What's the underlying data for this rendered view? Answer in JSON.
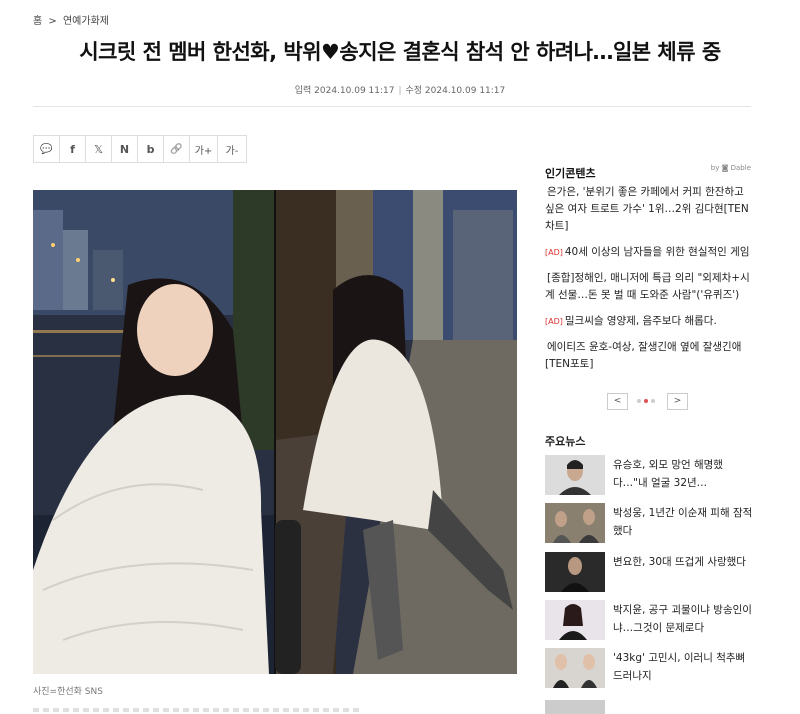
{
  "breadcrumb": {
    "home": "홈",
    "sep": ">",
    "section": "연예가화제"
  },
  "article": {
    "headline": "시크릿 전 멤버 한선화, 박위♥송지은 결혼식 참석 안 하려나…일본 체류 중",
    "input_label": "입력 2024.10.09 11:17",
    "date_sep": "|",
    "edit_label": "수정 2024.10.09 11:17",
    "caption": "사진=한선화 SNS"
  },
  "toolbar": {
    "comment_icon": "💬",
    "facebook_icon": "f",
    "x_icon": "𝕏",
    "naver_icon": "N",
    "band_icon": "b",
    "link_icon": "🔗",
    "font_up_label": "가+",
    "font_down_label": "가-"
  },
  "sidebar": {
    "popular_title": "인기콘텐츠",
    "dable_label": "by ◙ Dable",
    "popular": [
      {
        "ad": "",
        "text": "은가은, '분위기 좋은 카페에서 커피 한잔하고 싶은 여자 트로트 가수' 1위…2위 김다현[TEN차트]"
      },
      {
        "ad": "[AD]",
        "text": "40세 이상의 남자들을 위한 현실적인 게임"
      },
      {
        "ad": "",
        "text": "[종합]정해인, 매니저에 특급 의리 \"외제차+시계 선물…돈 못 벌 때 도와준 사람\"('유퀴즈')"
      },
      {
        "ad": "[AD]",
        "text": "밀크씨슬 영양제, 음주보다 해롭다."
      },
      {
        "ad": "",
        "text": "에이티즈 윤호-여상, 잘생긴애 옆에 잘생긴애 [TEN포토]"
      }
    ],
    "prev": "<",
    "next": ">",
    "news_title": "주요뉴스",
    "news": [
      {
        "text": "유승호, 외모 망언 해명했다…\"내 얼굴 32년…"
      },
      {
        "text": "박성웅, 1년간 이순재 피해 잠적했다"
      },
      {
        "text": "변요한, 30대 뜨겁게 사랑했다"
      },
      {
        "text": "박지윤, 공구 괴물이냐 방송인이냐…그것이 문제로다"
      },
      {
        "text": "'43kg' 고민시, 이러니 척추뼈 드러나지"
      }
    ]
  }
}
